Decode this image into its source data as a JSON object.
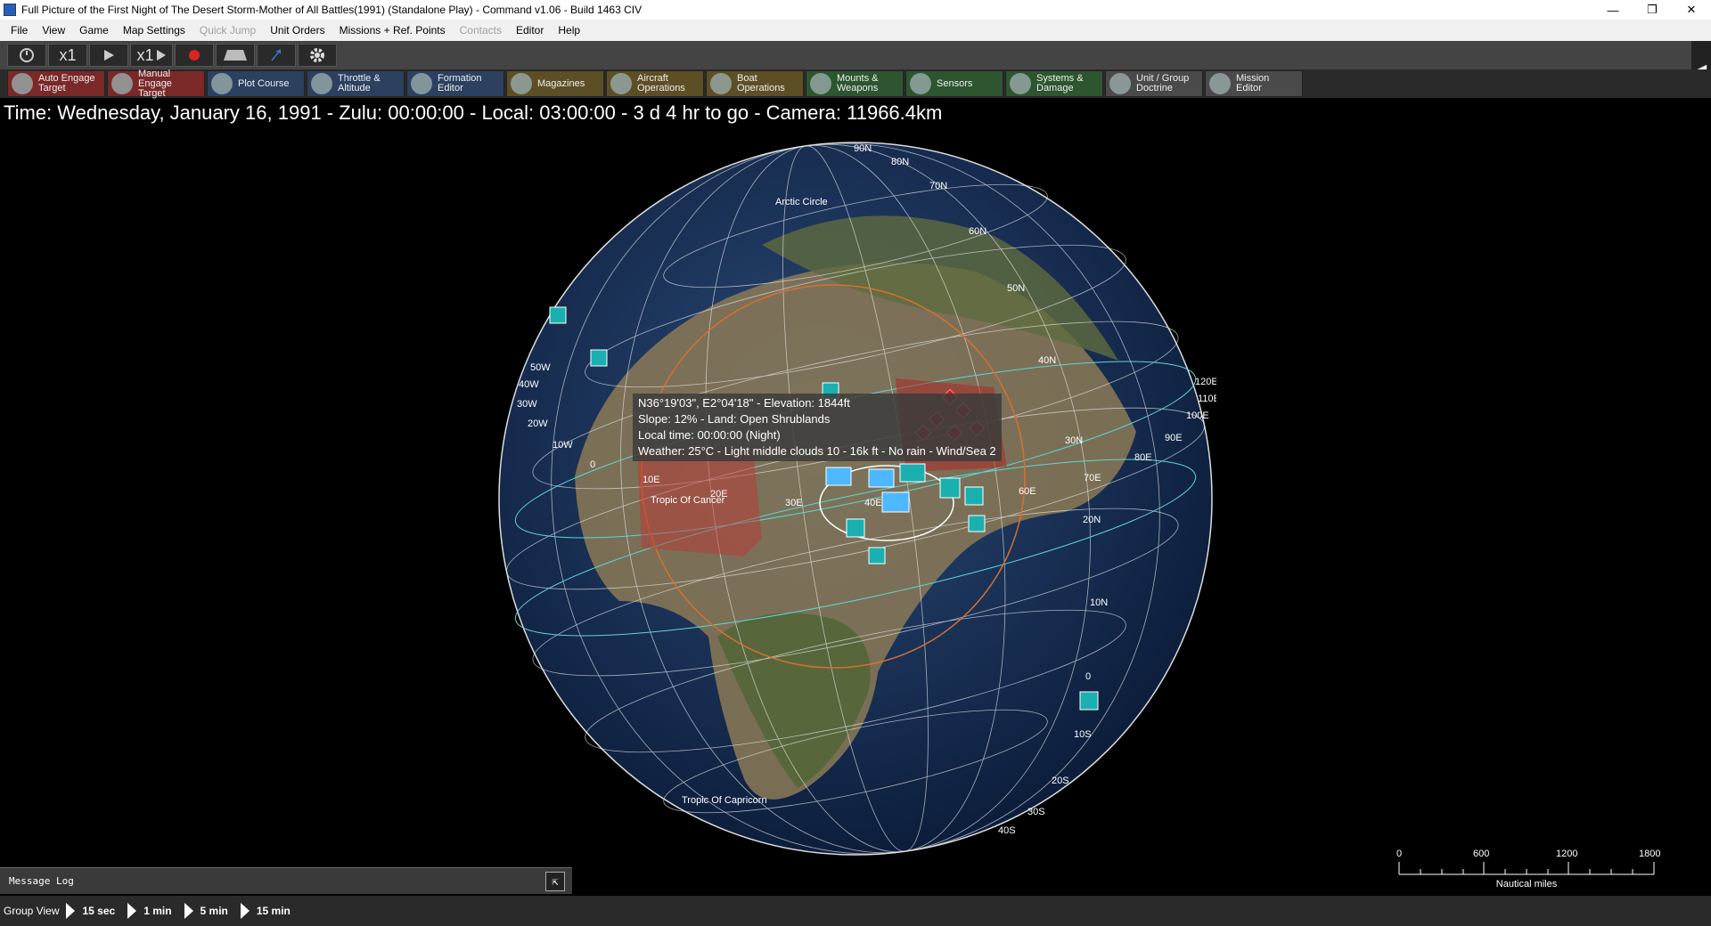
{
  "window": {
    "title": "Full Picture of the First Night of The Desert Storm-Mother of All Battles(1991) (Standalone Play) - Command v1.06 - Build 1463 CIV",
    "minimize": "—",
    "maximize": "❐",
    "close": "✕"
  },
  "menu": {
    "items": [
      {
        "label": "File"
      },
      {
        "label": "View"
      },
      {
        "label": "Game"
      },
      {
        "label": "Map Settings"
      },
      {
        "label": "Quick Jump"
      },
      {
        "label": "Unit Orders"
      },
      {
        "label": "Missions + Ref. Points"
      },
      {
        "label": "Contacts"
      },
      {
        "label": "Editor"
      },
      {
        "label": "Help"
      }
    ]
  },
  "toolbar": {
    "clock_icon": "clock-icon",
    "speed1": "x1",
    "play_icon": "play-icon",
    "speed2": "x1",
    "record_icon": "record-icon",
    "rewind_icon": "ramp-icon",
    "export_icon": "arrow-icon",
    "settings_icon": "gear-icon"
  },
  "commands": [
    {
      "label1": "Auto Engage",
      "label2": "Target",
      "color": "red"
    },
    {
      "label1": "Manual",
      "label2": "Engage Target",
      "color": "red"
    },
    {
      "label1": "Plot Course",
      "label2": "",
      "color": "blue"
    },
    {
      "label1": "Throttle &",
      "label2": "Altitude",
      "color": "blue"
    },
    {
      "label1": "Formation",
      "label2": "Editor",
      "color": "blue"
    },
    {
      "label1": "Magazines",
      "label2": "",
      "color": "gold"
    },
    {
      "label1": "Aircraft",
      "label2": "Operations",
      "color": "gold"
    },
    {
      "label1": "Boat",
      "label2": "Operations",
      "color": "gold"
    },
    {
      "label1": "Mounts &",
      "label2": "Weapons",
      "color": "green"
    },
    {
      "label1": "Sensors",
      "label2": "",
      "color": "green"
    },
    {
      "label1": "Systems &",
      "label2": "Damage",
      "color": "green"
    },
    {
      "label1": "Unit / Group",
      "label2": "Doctrine",
      "color": "gray"
    },
    {
      "label1": "Mission",
      "label2": "Editor",
      "color": "gray"
    }
  ],
  "status": {
    "time_line": "Time: Wednesday, January 16, 1991 - Zulu: 00:00:00 - Local: 03:00:00 - 3 d 4 hr to go - Camera: 11966.4km"
  },
  "map": {
    "labels": [
      "90N",
      "80N",
      "70N",
      "60N",
      "50N",
      "40N",
      "30N",
      "20N",
      "10N",
      "0",
      "10S",
      "20S",
      "30S",
      "40S",
      "50W",
      "40W",
      "30W",
      "20W",
      "10W",
      "0",
      "10E",
      "20E",
      "30E",
      "40E",
      "60E",
      "70E",
      "80E",
      "90E",
      "100E",
      "110E",
      "120E"
    ],
    "arctic": "Arctic Circle",
    "cancer": "Tropic Of Cancer",
    "capricorn": "Tropic Of Capricorn"
  },
  "tooltip": {
    "line1": "N36°19'03\", E2°04'18\" - Elevation: 1844ft",
    "line2": "Slope: 12%  - Land: Open Shrublands",
    "line3": "Local time: 00:00:00 (Night)",
    "line4": "Weather: 25°C - Light middle clouds 10 - 16k ft - No rain - Wind/Sea 2"
  },
  "scale_bar": {
    "ticks": [
      "0",
      "600",
      "1200",
      "1800"
    ],
    "unit": "Nautical miles"
  },
  "message_log": {
    "label": "Message Log",
    "expand_icon": "expand-icon"
  },
  "group_view": {
    "label": "Group View",
    "steps": [
      "15 sec",
      "1 min",
      "5 min",
      "15 min"
    ]
  }
}
